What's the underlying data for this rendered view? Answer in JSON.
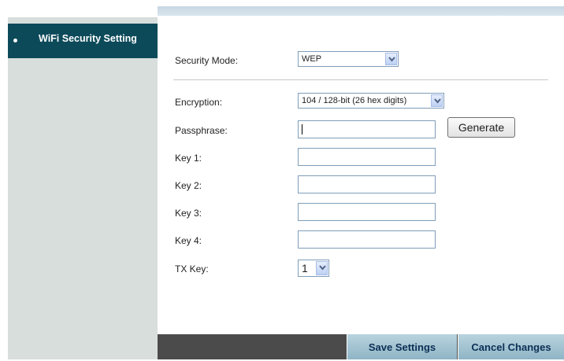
{
  "sidebar": {
    "items": [
      {
        "label": "WiFi Security Setting",
        "active": true
      }
    ]
  },
  "form": {
    "security_mode": {
      "label": "Security Mode:",
      "value": "WEP"
    },
    "encryption": {
      "label": "Encryption:",
      "value": "104 / 128-bit (26 hex digits)"
    },
    "passphrase": {
      "label": "Passphrase:",
      "value": ""
    },
    "generate_label": "Generate",
    "key1": {
      "label": "Key 1:",
      "value": ""
    },
    "key2": {
      "label": "Key 2:",
      "value": ""
    },
    "key3": {
      "label": "Key 3:",
      "value": ""
    },
    "key4": {
      "label": "Key 4:",
      "value": ""
    },
    "tx_key": {
      "label": "TX Key:",
      "value": "1"
    }
  },
  "footer": {
    "save_label": "Save Settings",
    "cancel_label": "Cancel Changes"
  },
  "colors": {
    "sidebar_bg": "#d7dedc",
    "sidebar_active_bg": "#0c4a5a",
    "footer_bg": "#4b4b4b",
    "footer_button_bg": "#a8c8d6",
    "footer_button_text": "#0d2f55"
  },
  "icons": {
    "bullet": "bullet-dot-icon",
    "dropdown": "chevron-down-icon"
  }
}
